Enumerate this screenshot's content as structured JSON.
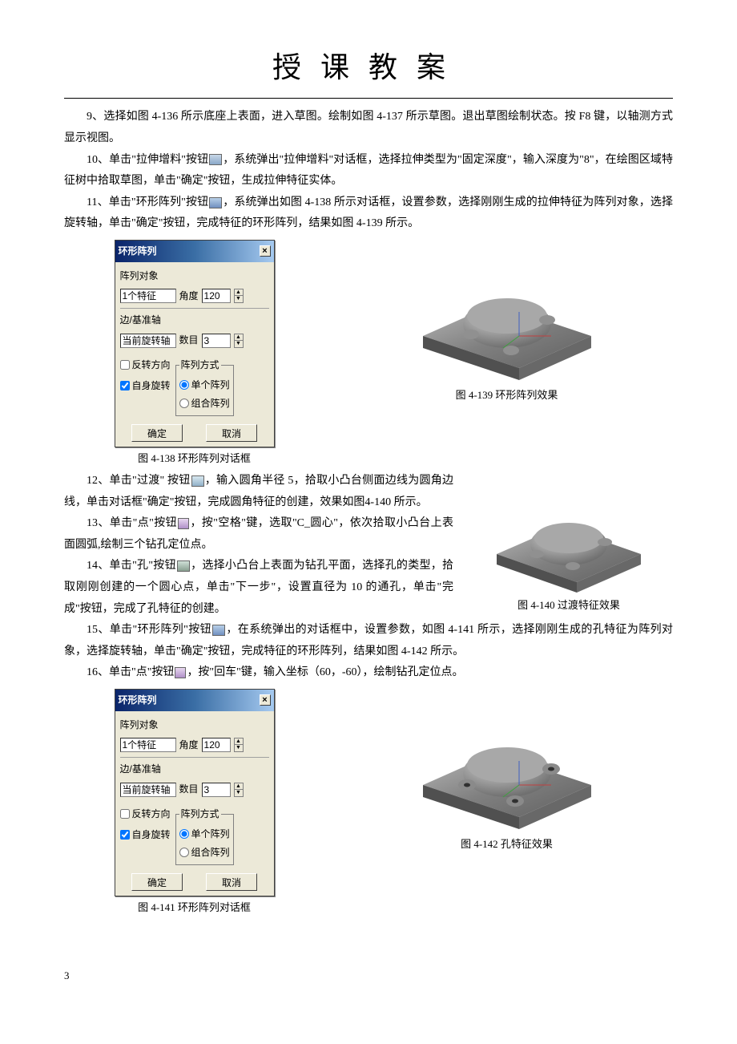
{
  "title": "授课教案",
  "paragraphs": {
    "p9": "9、选择如图 4-136 所示底座上表面，进入草图。绘制如图 4-137 所示草图。退出草图绘制状态。按 F8 键，以轴测方式显示视图。",
    "p10": "10、单击\"拉伸增料\"按钮",
    "p10b": "，系统弹出\"拉伸增料\"对话框，选择拉伸类型为\"固定深度\"，输入深度为\"8\"，在绘图区域特征树中拾取草图，单击\"确定\"按钮，生成拉伸特征实体。",
    "p11": "11、单击\"环形阵列\"按钮",
    "p11b": "，系统弹出如图 4-138 所示对话框，设置参数，选择刚刚生成的拉伸特征为阵列对象，选择旋转轴，单击\"确定\"按钮，完成特征的环形阵列，结果如图 4-139 所示。",
    "p12": "12、单击\"过渡\" 按钮",
    "p12b": "，输入圆角半径 5，拾取小凸台侧面边线为圆角边线，单击对话框\"确定\"按钮，完成圆角特征的创建，效果如图4-140 所示。",
    "p13": "13、单击\"点\"按钮",
    "p13b": "，按\"空格\"键，选取\"C_圆心\"，依次拾取小凸台上表面圆弧,绘制三个钻孔定位点。",
    "p14": "14、单击\"孔\"按钮",
    "p14b": "，选择小凸台上表面为钻孔平面，选择孔的类型，拾取刚刚创建的一个圆心点，单击\"下一步\"，设置直径为 10 的通孔，单击\"完成\"按钮，完成了孔特征的创建。",
    "p15": "15、单击\"环形阵列\"按钮",
    "p15b": "，在系统弹出的对话框中，设置参数，如图 4-141 所示，选择刚刚生成的孔特征为阵列对象，选择旋转轴，单击\"确定\"按钮，完成特征的环形阵列，结果如图 4-142 所示。",
    "p16": "16、单击\"点\"按钮",
    "p16b": "，按\"回车\"键，输入坐标（60，-60），绘制钻孔定位点。"
  },
  "dialog": {
    "title": "环形阵列",
    "objLabel": "阵列对象",
    "objField": "1个特征",
    "angleLabel": "角度",
    "angleValue": "120",
    "axisLabel": "边/基准轴",
    "axisField": "当前旋转轴",
    "countLabel": "数目",
    "countValue": "3",
    "reverse": "反转方向",
    "selfrotate": "自身旋转",
    "modeLegend": "阵列方式",
    "radioSingle": "单个阵列",
    "radioGroup": "组合阵列",
    "ok": "确定",
    "cancel": "取消"
  },
  "captions": {
    "c138": "图 4-138  环形阵列对话框",
    "c139": "图 4-139  环形阵列效果",
    "c140": "图 4-140  过渡特征效果",
    "c141": "图 4-141 环形阵列对话框",
    "c142": "图 4-142 孔特征效果"
  },
  "pageNumber": "3"
}
